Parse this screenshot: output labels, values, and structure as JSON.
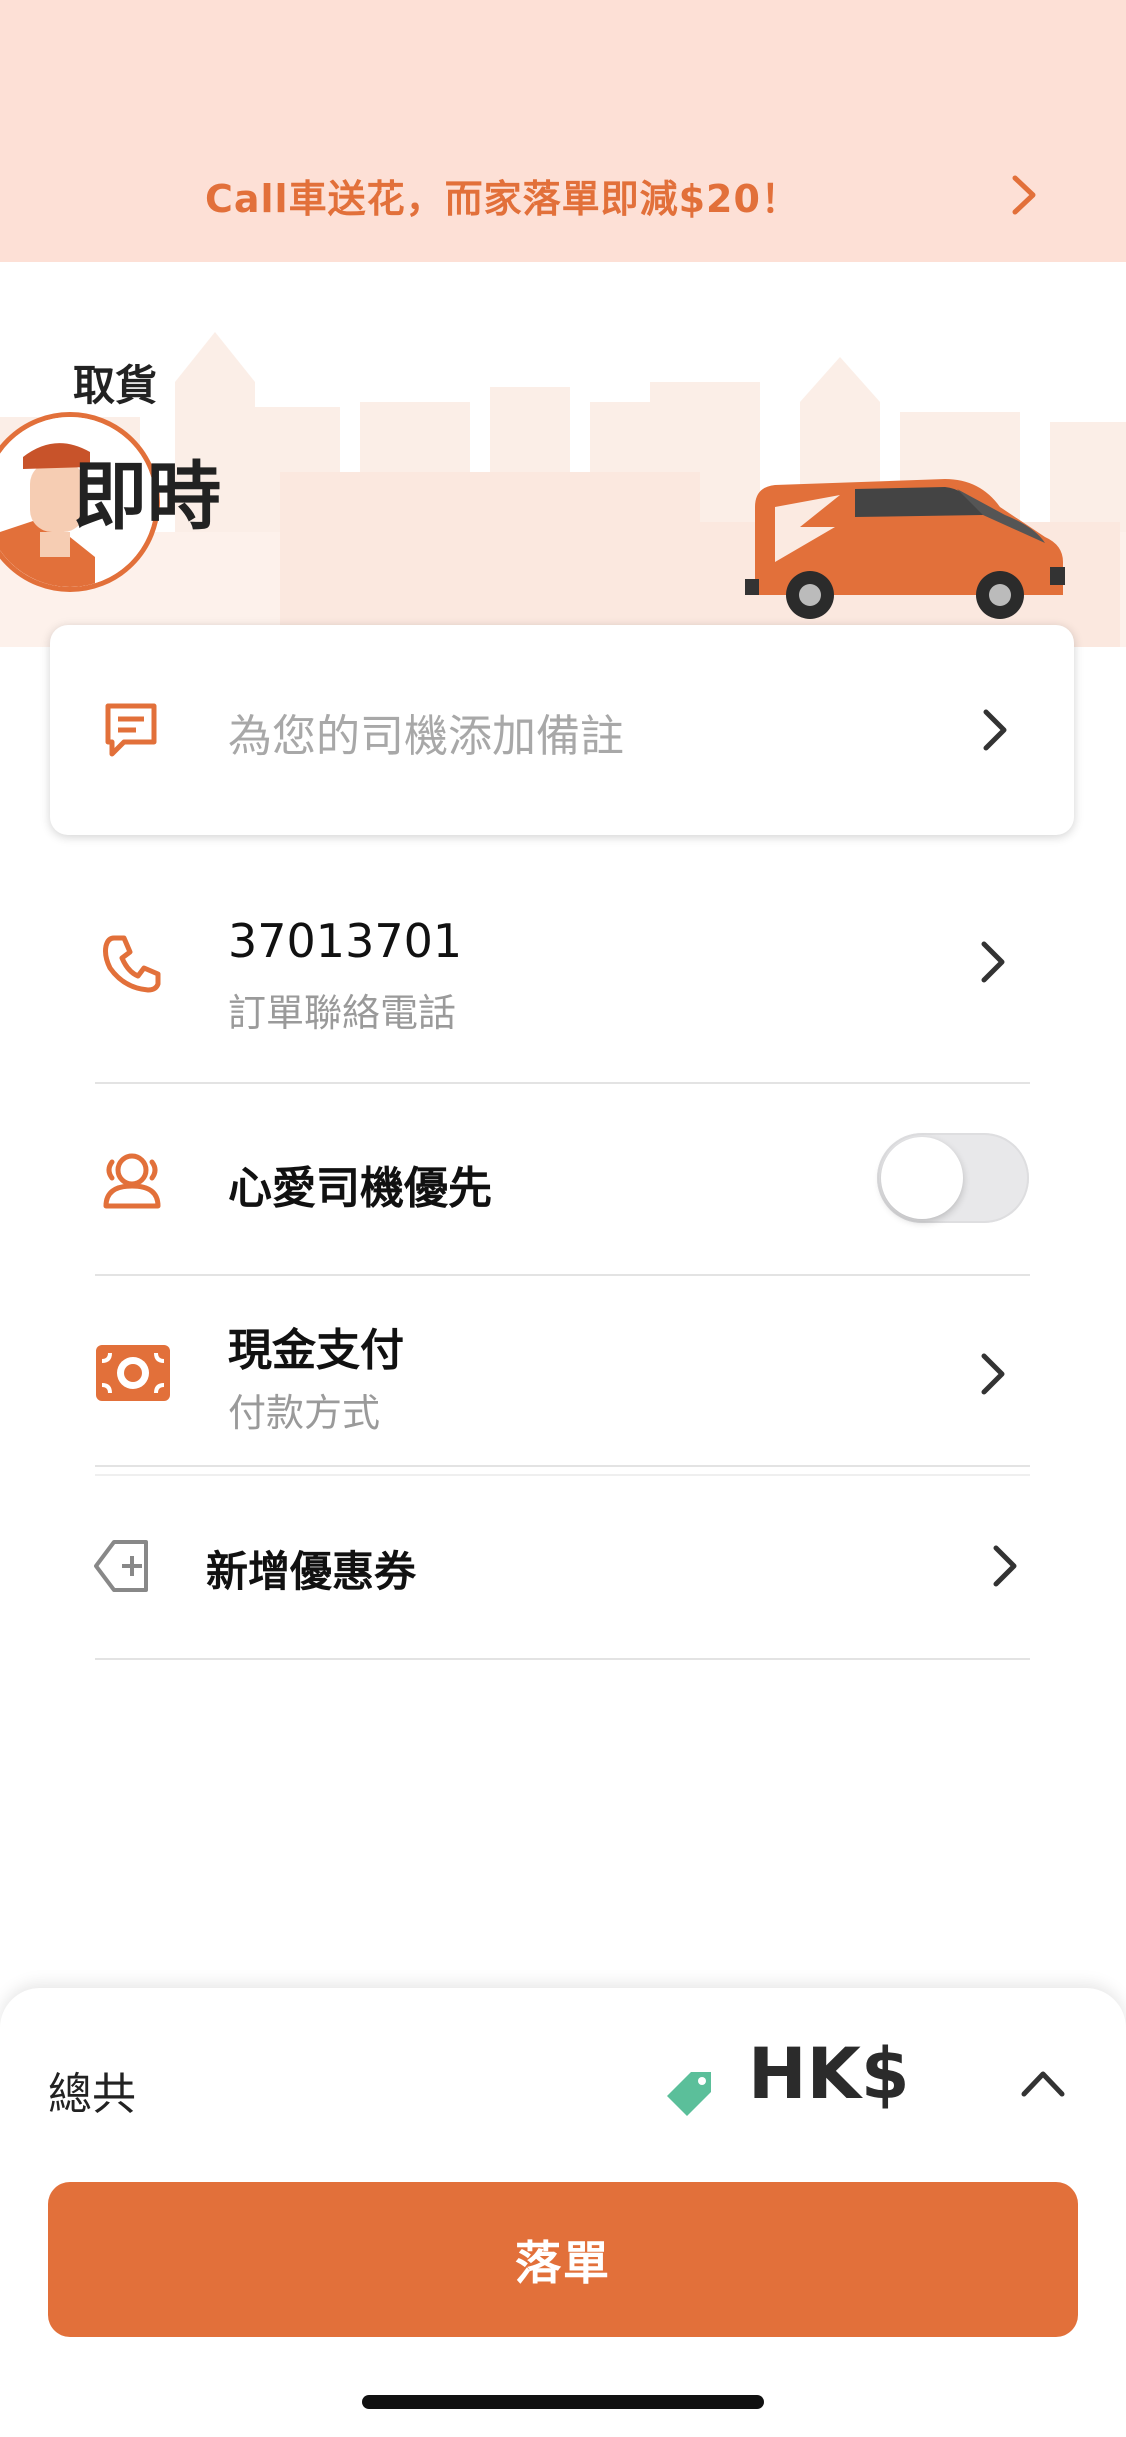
{
  "promo": {
    "text": "Call車送花，而家落單即減$20！"
  },
  "pickup": {
    "label": "取貨",
    "time": "即時"
  },
  "note": {
    "placeholder": "為您的司機添加備註"
  },
  "contact": {
    "phone": "37013701",
    "label": "訂單聯絡電話"
  },
  "favourite_driver": {
    "label": "心愛司機優先",
    "enabled": false
  },
  "payment": {
    "method": "現金支付",
    "label": "付款方式"
  },
  "coupon": {
    "label": "新增優惠券"
  },
  "summary": {
    "total_label": "總共",
    "currency": "HK$"
  },
  "actions": {
    "place_order": "落單"
  },
  "colors": {
    "accent": "#e2703a",
    "promo_bg": "#fde0d6",
    "tag": "#5bbf9a"
  },
  "icons": [
    "promo-chevron-right-icon",
    "note-icon",
    "phone-icon",
    "favourite-driver-icon",
    "cash-icon",
    "coupon-tag-icon",
    "price-tag-icon",
    "chevron-up-icon"
  ]
}
